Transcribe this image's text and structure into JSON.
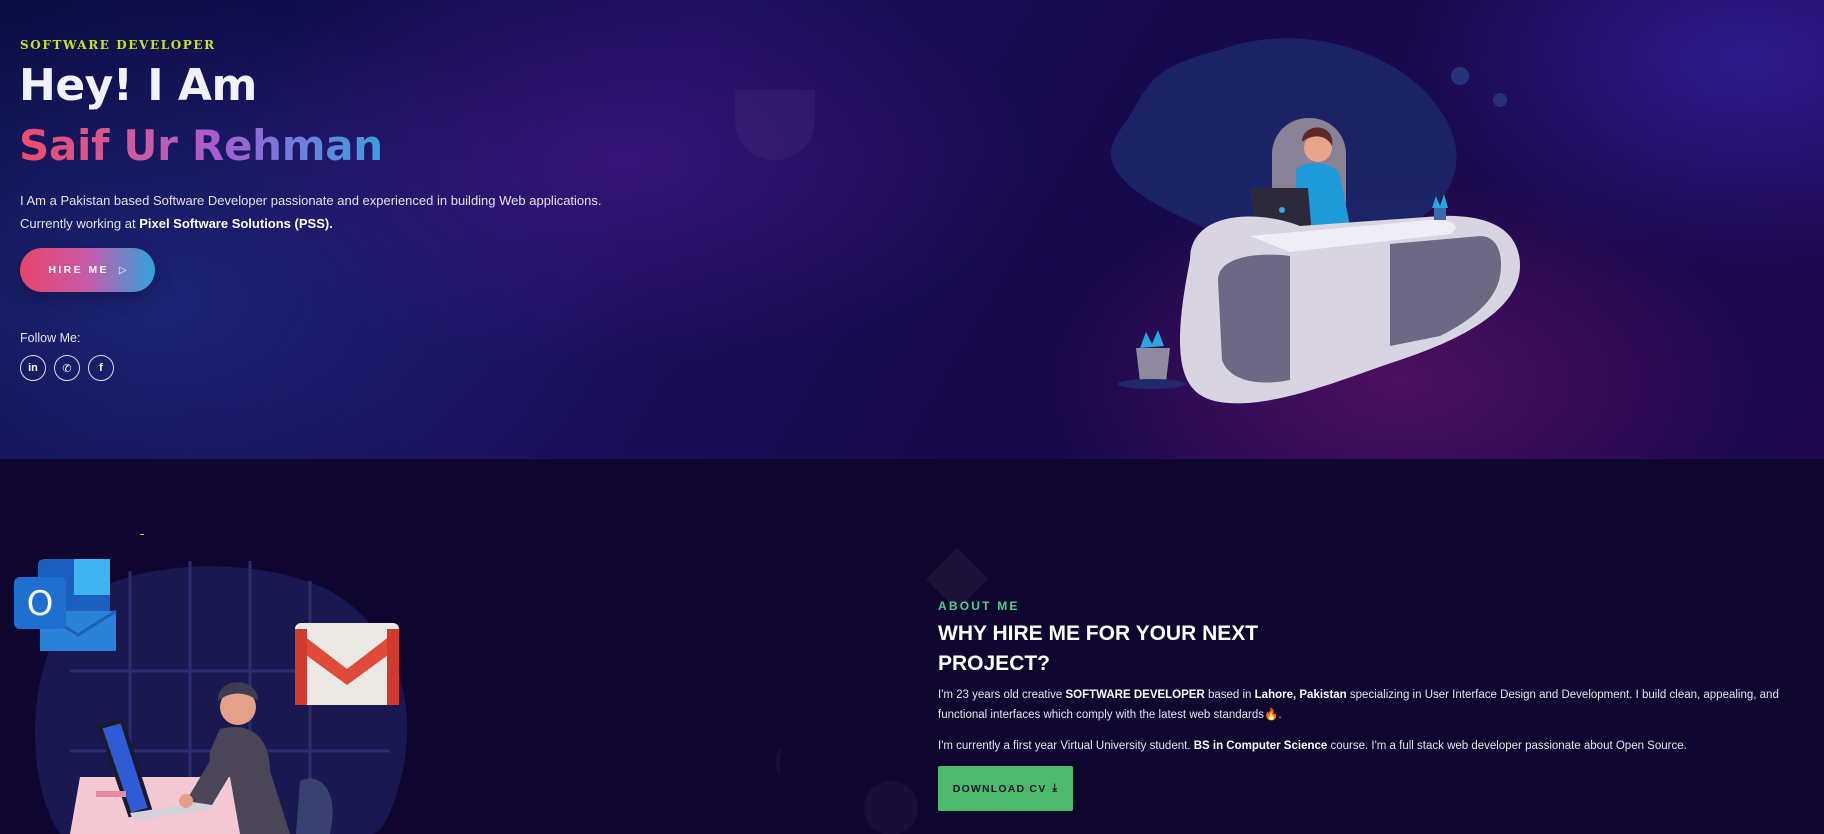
{
  "hero": {
    "eyebrow": "SOFTWARE DEVELOPER",
    "greeting": "Hey! I Am",
    "name": "Saif Ur Rehman",
    "intro_line1": "I Am a Pakistan based Software Developer passionate and experienced in building Web applications.",
    "intro_line2_prefix": "Currently working at ",
    "intro_line2_company": "Pixel Software Solutions (PSS).",
    "hire_label": "HIRE ME",
    "hire_icon": "arrow-right-icon",
    "follow_label": "Follow Me:",
    "socials": [
      {
        "name": "linkedin-icon",
        "glyph": "in"
      },
      {
        "name": "whatsapp-icon",
        "glyph": "✆"
      },
      {
        "name": "facebook-icon",
        "glyph": "f"
      }
    ]
  },
  "about": {
    "label": "ABOUT ME",
    "title_line1": "WHY HIRE ME FOR YOUR NEXT",
    "title_line2": "PROJECT?",
    "p1_a": "I'm 23 years old creative ",
    "p1_b": "SOFTWARE DEVELOPER",
    "p1_c": " based in ",
    "p1_d": "Lahore, Pakistan",
    "p1_e": " specializing in User Interface Design and Development. I build clean, appealing, and functional interfaces which comply with the latest web standards",
    "p1_emoji": "🔥",
    "p1_end": ".",
    "p2_a": "I'm currently a first year Virtual University student. ",
    "p2_b": "BS in Computer Science",
    "p2_c": " course. I'm a  full stack web developer passionate about Open Source.",
    "cv_label": "DOWNLOAD CV",
    "cv_icon": "download-icon"
  },
  "colors": {
    "eyebrow": "#c8e21a",
    "about_label": "#4bd18a",
    "cv_button": "#4cb96d",
    "name_gradient_start": "#ef4b6b",
    "name_gradient_end": "#3b9fe0"
  }
}
